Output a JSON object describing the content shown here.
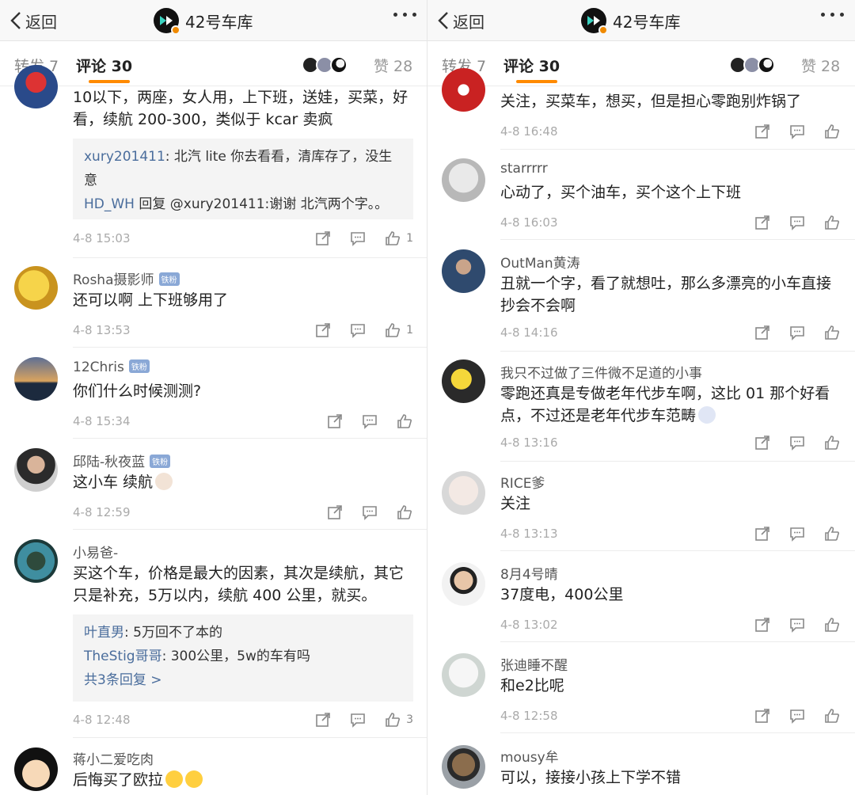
{
  "header": {
    "back_label": "返回",
    "title": "42号车库"
  },
  "tabs": {
    "repost_label": "转发 7",
    "comment_label": "评论 30",
    "like_label": "赞 28"
  },
  "fan_badge": "铁粉",
  "left_comments": [
    {
      "name": "",
      "text": "10以下，两座，女人用，上下班，送娃，买菜，好看，续航 200-300，类似于 kcar 卖疯",
      "replies": [
        {
          "who": "xury201411",
          "text": ": 北汽 lite 你去看看，清库存了，没生意"
        },
        {
          "who": "HD_WH",
          "text": " 回复 @xury201411:谢谢  北汽两个字。。"
        }
      ],
      "more_replies": "",
      "time": "4-8 15:03",
      "likes": "1"
    },
    {
      "name": "Rosha摄影师",
      "text": "还可以啊 上下班够用了",
      "time": "4-8 13:53",
      "likes": "1"
    },
    {
      "name": "12Chris",
      "text": "你们什么时候测测?",
      "time": "4-8 15:34",
      "likes": ""
    },
    {
      "name": "邱陆-秋夜蓝",
      "text": "这小车 续航",
      "time": "4-8 12:59",
      "likes": ""
    },
    {
      "name": "小易爸-",
      "text": "买这个车，价格是最大的因素，其次是续航，其它只是补充，5万以内，续航 400 公里，就买。",
      "replies": [
        {
          "who": "叶直男",
          "text": ": 5万回不了本的"
        },
        {
          "who": "TheStig哥哥",
          "text": ": 300公里，5w的车有吗"
        }
      ],
      "more_replies": "共3条回复 >",
      "time": "4-8 12:48",
      "likes": "3"
    },
    {
      "name": "蒋小二爱吃肉",
      "text": "后悔买了欧拉",
      "time": "",
      "likes": ""
    }
  ],
  "right_comments": [
    {
      "name": "",
      "text": "关注，买菜车，想买，但是担心零跑别炸锅了",
      "time": "4-8 16:48"
    },
    {
      "name": "starrrrr",
      "text": "心动了，买个油车，买个这个上下班",
      "time": "4-8 16:03"
    },
    {
      "name": "OutMan黄涛",
      "text": "丑就一个字，看了就想吐，那么多漂亮的小车直接抄会不会啊",
      "time": "4-8 14:16"
    },
    {
      "name": "我只不过做了三件微不足道的小事",
      "text": "零跑还真是专做老年代步车啊，这比 01 那个好看点，不过还是老年代步车范畴",
      "time": "4-8 13:16"
    },
    {
      "name": "RICE爹",
      "text": "关注",
      "time": "4-8 13:13"
    },
    {
      "name": "8月4号晴",
      "text": "37度电，400公里",
      "time": "4-8 13:02"
    },
    {
      "name": "张迪睡不醒",
      "text": "和e2比呢",
      "time": "4-8 12:58"
    },
    {
      "name": "mousy牟",
      "text": "可以，接接小孩上下学不错",
      "time": ""
    }
  ],
  "colors": {
    "accent": "#ff8a00",
    "link": "#4a6d9c",
    "fan_badge": "#8aa8d6"
  }
}
